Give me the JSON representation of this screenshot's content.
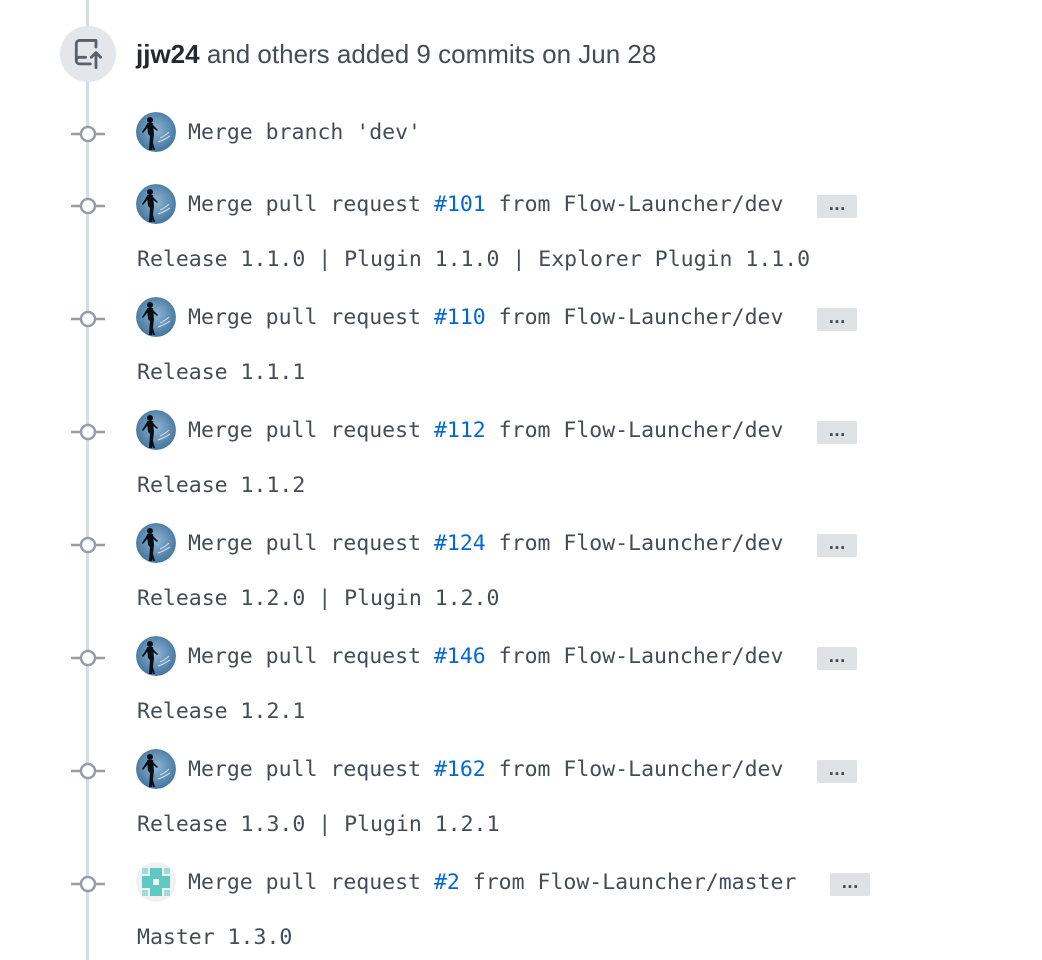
{
  "event": {
    "icon": "repo-push-icon",
    "author": "jjw24",
    "summary": " and others added 9 commits on Jun 28"
  },
  "commits": [
    {
      "avatar": "avatar-dark-figure",
      "title_prefix": "Merge branch 'dev'",
      "pr_number": "",
      "title_suffix": "",
      "has_ellipsis": false,
      "description": ""
    },
    {
      "avatar": "avatar-dark-figure",
      "title_prefix": "Merge pull request ",
      "pr_number": "#101",
      "title_suffix": " from Flow-Launcher/dev",
      "has_ellipsis": true,
      "description": "Release 1.1.0 | Plugin 1.1.0 | Explorer Plugin 1.1.0"
    },
    {
      "avatar": "avatar-dark-figure",
      "title_prefix": "Merge pull request ",
      "pr_number": "#110",
      "title_suffix": " from Flow-Launcher/dev",
      "has_ellipsis": true,
      "description": "Release 1.1.1"
    },
    {
      "avatar": "avatar-dark-figure",
      "title_prefix": "Merge pull request ",
      "pr_number": "#112",
      "title_suffix": " from Flow-Launcher/dev",
      "has_ellipsis": true,
      "description": "Release 1.1.2"
    },
    {
      "avatar": "avatar-dark-figure",
      "title_prefix": "Merge pull request ",
      "pr_number": "#124",
      "title_suffix": " from Flow-Launcher/dev",
      "has_ellipsis": true,
      "description": "Release 1.2.0 | Plugin 1.2.0"
    },
    {
      "avatar": "avatar-dark-figure",
      "title_prefix": "Merge pull request ",
      "pr_number": "#146",
      "title_suffix": " from Flow-Launcher/dev",
      "has_ellipsis": true,
      "description": "Release 1.2.1"
    },
    {
      "avatar": "avatar-dark-figure",
      "title_prefix": "Merge pull request ",
      "pr_number": "#162",
      "title_suffix": " from Flow-Launcher/dev",
      "has_ellipsis": true,
      "description": "Release 1.3.0 | Plugin 1.2.1"
    },
    {
      "avatar": "avatar-teal-identicon",
      "title_prefix": "Merge pull request ",
      "pr_number": "#2",
      "title_suffix": " from Flow-Launcher/master",
      "has_ellipsis": true,
      "description": "Master 1.3.0"
    }
  ],
  "ellipsis_label": "...",
  "colors": {
    "link": "#0366d6",
    "text": "#444d56",
    "timeline": "#d8dce1",
    "badge_bg": "#e3e6ea"
  }
}
